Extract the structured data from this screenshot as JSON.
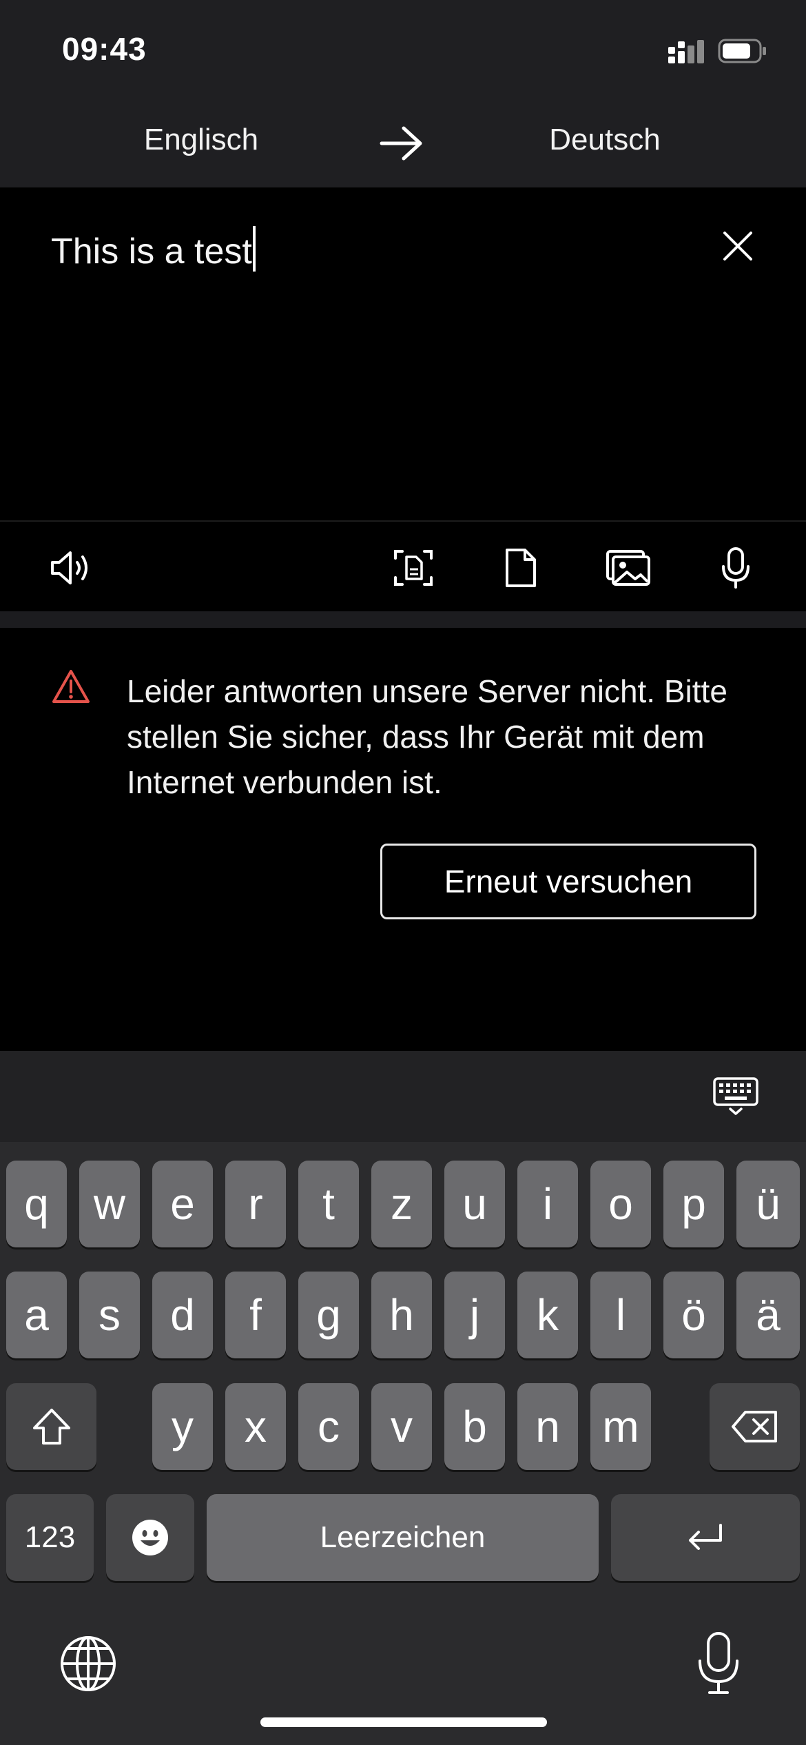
{
  "status_bar": {
    "time": "09:43"
  },
  "header": {
    "source_language": "Englisch",
    "target_language": "Deutsch"
  },
  "input": {
    "text": "This is a test"
  },
  "error": {
    "message": "Leider antworten unsere Server nicht. Bitte stellen Sie sicher, dass Ihr Gerät mit dem Internet verbunden ist.",
    "retry_label": "Erneut versuchen"
  },
  "keyboard": {
    "row1": [
      "q",
      "w",
      "e",
      "r",
      "t",
      "z",
      "u",
      "i",
      "o",
      "p",
      "ü"
    ],
    "row2": [
      "a",
      "s",
      "d",
      "f",
      "g",
      "h",
      "j",
      "k",
      "l",
      "ö",
      "ä"
    ],
    "row3": [
      "y",
      "x",
      "c",
      "v",
      "b",
      "n",
      "m"
    ],
    "numbers_label": "123",
    "space_label": "Leerzeichen"
  },
  "colors": {
    "background": "#000000",
    "header_bg": "#1f1f22",
    "keyboard_bg": "#2b2b2d",
    "key_bg": "#6b6b6e",
    "warning": "#e5534b"
  },
  "icons": [
    "signal-icon",
    "battery-icon",
    "swap-arrow-icon",
    "close-icon",
    "speaker-icon",
    "scan-text-icon",
    "document-icon",
    "image-icon",
    "microphone-icon",
    "warning-icon",
    "keyboard-dismiss-icon",
    "shift-icon",
    "backspace-icon",
    "emoji-icon",
    "return-icon",
    "globe-icon",
    "dictation-icon"
  ]
}
